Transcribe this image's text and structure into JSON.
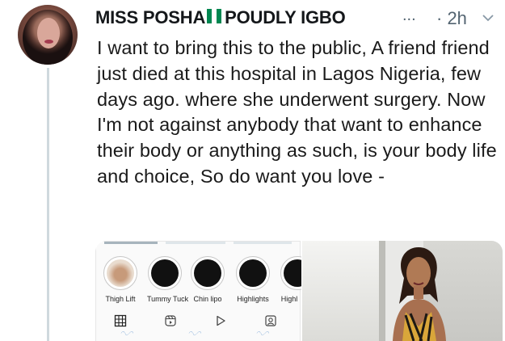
{
  "tweet": {
    "author_name": "MISS POSHA",
    "author_name_suffix": "POUDLY IGBO",
    "ellipsis": "...",
    "timestamp": "· 2h",
    "flag_colors": [
      "#008751",
      "#ffffff",
      "#008751"
    ],
    "text": "I want to bring this to the public, A friend friend just died at this hospital in Lagos Nigeria, few days ago. where she underwent surgery. Now I'm not against anybody that want to enhance their body or anything as such, is your body life and choice, So do want you love -"
  },
  "media": {
    "highlights": [
      {
        "label": "Thigh Lift"
      },
      {
        "label": "Tummy Tuck"
      },
      {
        "label": "Chin lipo"
      },
      {
        "label": "Highlights"
      },
      {
        "label": "Highl"
      }
    ],
    "profile_tabs": [
      "grid-icon",
      "reels-icon",
      "play-icon",
      "tagged-icon"
    ]
  },
  "colors": {
    "text": "#14171a",
    "secondary": "#536471",
    "thread_line": "#cfd9de"
  }
}
